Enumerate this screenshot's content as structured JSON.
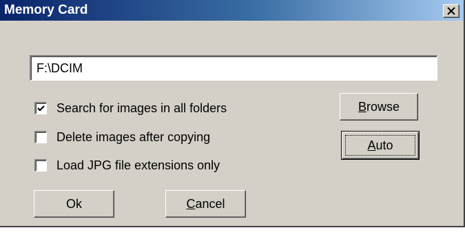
{
  "window": {
    "title": "Memory Card",
    "close_glyph": "×"
  },
  "path_field": {
    "value": "F:\\DCIM"
  },
  "options": [
    {
      "label": "Search for images in all folders",
      "checked": true
    },
    {
      "label": "Delete images after copying",
      "checked": false
    },
    {
      "label": "Load JPG file extensions only",
      "checked": false
    }
  ],
  "buttons": {
    "browse": {
      "mnemonic": "B",
      "rest": "rowse"
    },
    "auto": {
      "mnemonic": "A",
      "rest": "uto"
    },
    "ok": {
      "label": "Ok"
    },
    "cancel": {
      "mnemonic": "C",
      "rest": "ancel"
    }
  },
  "icons": {
    "close": "close-icon",
    "check": "checkmark-icon"
  },
  "colors": {
    "face": "#d4d0c8",
    "title_start": "#0a246a",
    "title_end": "#a6caf0"
  }
}
